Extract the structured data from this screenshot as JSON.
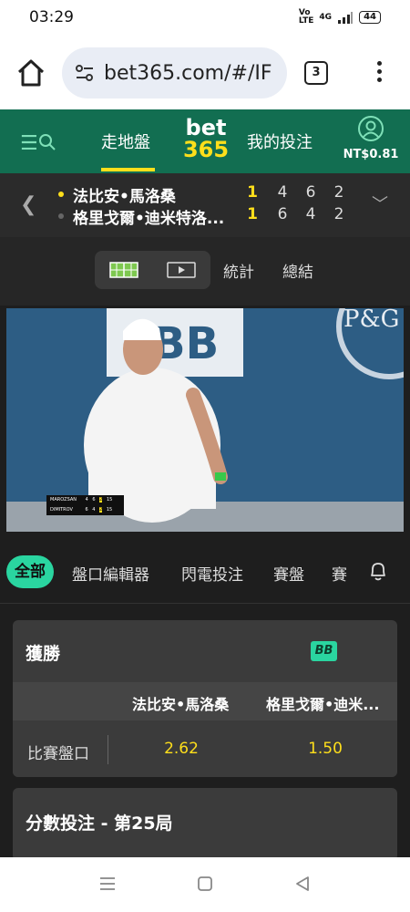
{
  "status_bar": {
    "time": "03:29",
    "network": "4G",
    "battery": "44"
  },
  "browser": {
    "url": "bet365.com/#/IF",
    "tab_count": "3"
  },
  "header": {
    "nav_inplay": "走地盤",
    "nav_mybets": "我的投注",
    "logo_top": "bet",
    "logo_bottom": "365",
    "balance": "NT$0.81"
  },
  "scoreboard": {
    "players": [
      {
        "name": "法比安•馬洛桑",
        "serving": true,
        "scores": [
          "1",
          "4",
          "6",
          "2"
        ]
      },
      {
        "name": "格里戈爾•迪米特洛...",
        "serving": false,
        "scores": [
          "1",
          "6",
          "4",
          "2"
        ]
      }
    ]
  },
  "view_tabs": {
    "stats": "統計",
    "summary": "總結"
  },
  "video": {
    "scorebug": [
      {
        "name": "MAROZSAN",
        "scores": [
          "4",
          "6",
          "2",
          "15"
        ]
      },
      {
        "name": "DIMITROV",
        "scores": [
          "6",
          "4",
          "2",
          "15"
        ]
      }
    ]
  },
  "filters": {
    "active": "全部",
    "items": [
      "盤口編輯器",
      "閃電投注",
      "賽盤",
      "賽"
    ]
  },
  "market": {
    "title": "獲勝",
    "badge": "BB",
    "col1": "法比安•馬洛桑",
    "col2": "格里戈爾•迪米...",
    "row_label": "比賽盤口",
    "odds1": "2.62",
    "odds2": "1.50"
  },
  "market2": {
    "title": "分數投注 - 第25局"
  },
  "colors": {
    "brand_green": "#126e51",
    "accent": "#2ad5a0",
    "odds_yellow": "#ffdf1b"
  }
}
